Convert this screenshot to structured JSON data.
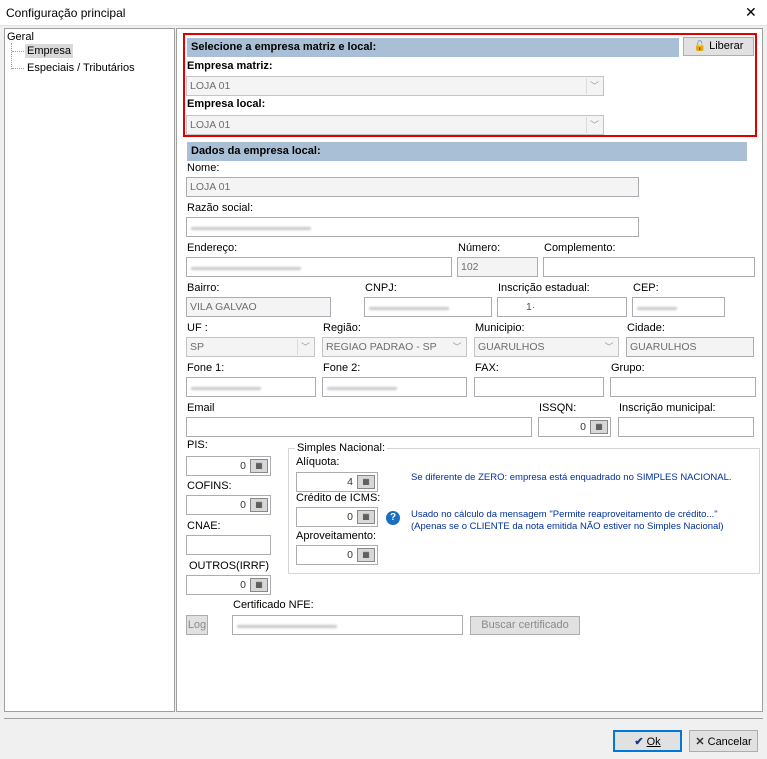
{
  "window": {
    "title": "Configuração principal"
  },
  "tree": {
    "root": "Geral",
    "items": [
      "Empresa",
      "Especiais / Tributários"
    ]
  },
  "matriz_section": {
    "header": "Selecione a empresa matriz e local:",
    "liberar_label": "Liberar",
    "matriz_label": "Empresa matriz:",
    "matriz_value": "LOJA 01",
    "local_label": "Empresa local:",
    "local_value": "LOJA 01"
  },
  "dados_section": {
    "header": "Dados da empresa local:",
    "nome_label": "Nome:",
    "nome_value": "LOJA 01",
    "razao_label": "Razão social:",
    "endereco_label": "Endereço:",
    "numero_label": "Número:",
    "numero_value": "102",
    "complemento_label": "Complemento:",
    "bairro_label": "Bairro:",
    "bairro_value": "VILA GALVAO",
    "cnpj_label": "CNPJ:",
    "ie_label": "Inscrição estadual:",
    "ie_value": "1·",
    "cep_label": "CEP:",
    "uf_label": "UF :",
    "uf_value": "SP",
    "regiao_label": "Região:",
    "regiao_value": "REGIAO PADRAO - SP",
    "municipio_label": "Municipio:",
    "municipio_value": "GUARULHOS",
    "cidade_label": "Cidade:",
    "cidade_value": "GUARULHOS",
    "fone1_label": "Fone 1:",
    "fone2_label": "Fone 2:",
    "fax_label": "FAX:",
    "grupo_label": "Grupo:",
    "email_label": "Email",
    "issqn_label": "ISSQN:",
    "issqn_value": "0",
    "im_label": "Inscrição municipal:"
  },
  "taxes": {
    "pis_label": "PIS:",
    "pis_value": "0",
    "cofins_label": "COFINS:",
    "cofins_value": "0",
    "cnae_label": "CNAE:",
    "outros_label": "OUTROS(IRRF)",
    "outros_value": "0"
  },
  "simples": {
    "group_label": "Simples Nacional:",
    "aliquota_label": "Alíquota:",
    "aliquota_value": "4",
    "icms_label": "Crédito de ICMS:",
    "icms_value": "0",
    "aprov_label": "Aproveitamento:",
    "aprov_value": "0",
    "info1": "Se diferente de ZERO: empresa está enquadrado no SIMPLES NACIONAL.",
    "info2": "Usado no cálculo da mensagem \"Permite reaproveitamento de crédito...\"",
    "info3": "(Apenas se o CLIENTE da nota emitida NÃO estiver no Simples Nacional)"
  },
  "certificado": {
    "log_label": "Log",
    "cert_label": "Certificado NFE:",
    "buscar_label": "Buscar certificado"
  },
  "footer": {
    "ok_label": "Ok",
    "cancel_label": "Cancelar"
  }
}
